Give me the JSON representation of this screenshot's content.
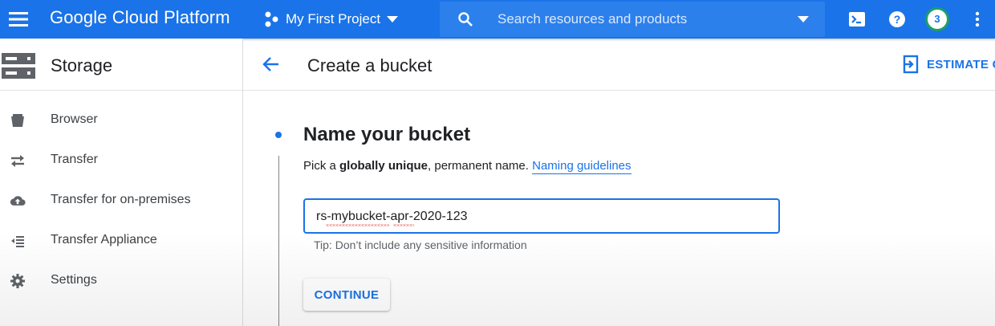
{
  "topbar": {
    "brand": "Google Cloud Platform",
    "project": "My First Project",
    "search_placeholder": "Search resources and products",
    "avatar_initial": "3",
    "colors": {
      "bar": "#1a73e8",
      "avatar_ring": "#1e9e6a"
    },
    "icons": [
      "menu-icon",
      "project-nodes-icon",
      "chevron-down-icon",
      "search-icon",
      "cloud-shell-icon",
      "help-icon",
      "more-vert-icon"
    ]
  },
  "sidebar": {
    "title": "Storage",
    "items": [
      {
        "label": "Browser",
        "icon": "bucket-icon"
      },
      {
        "label": "Transfer",
        "icon": "transfer-arrows-icon"
      },
      {
        "label": "Transfer for on-premises",
        "icon": "cloud-upload-icon"
      },
      {
        "label": "Transfer Appliance",
        "icon": "appliance-list-icon"
      },
      {
        "label": "Settings",
        "icon": "gear-icon"
      }
    ]
  },
  "main": {
    "title": "Create a bucket",
    "estimate_label": "ESTIMATE C",
    "step": {
      "title": "Name your bucket",
      "desc_prefix": "Pick a ",
      "desc_bold": "globally unique",
      "desc_suffix": ", permanent name. ",
      "link": "Naming guidelines",
      "input_value": "rs-mybucket-apr-2020-123",
      "tip": "Tip: Don’t include any sensitive information",
      "continue_label": "CONTINUE"
    }
  }
}
